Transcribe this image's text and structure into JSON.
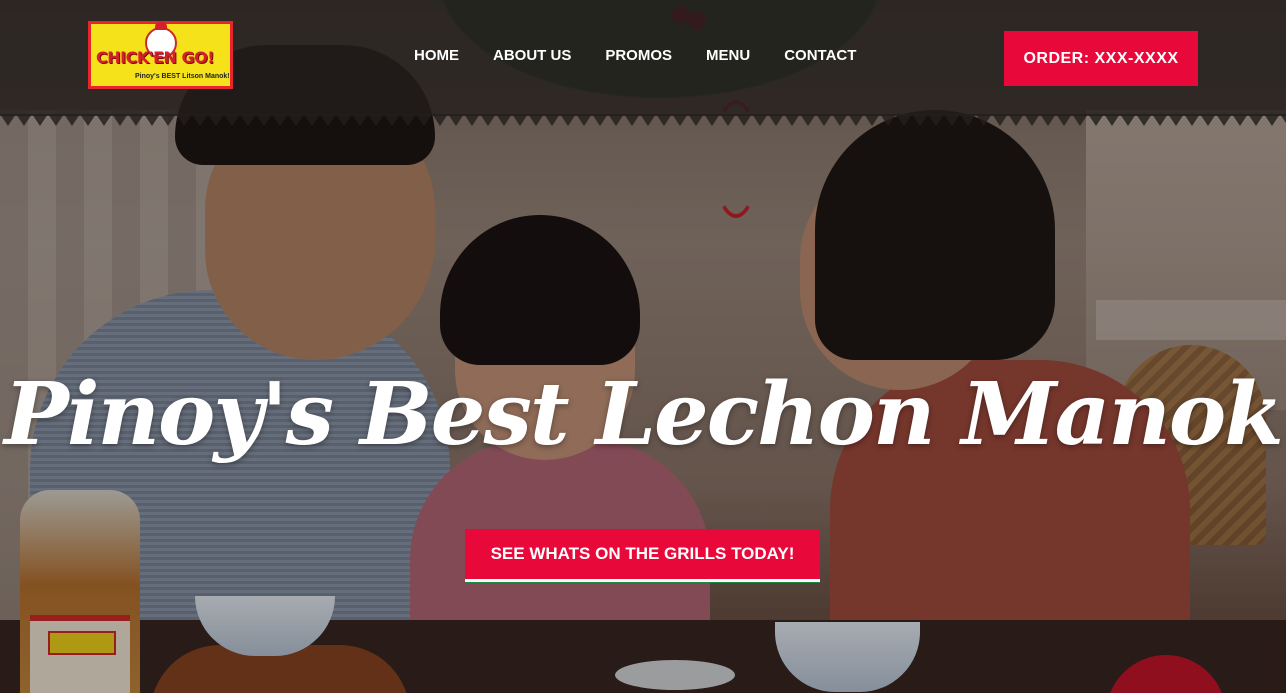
{
  "brand": {
    "logo_text": "CHICK'EN GO!",
    "logo_tagline": "Pinoy's BEST Litson Manok!"
  },
  "nav": {
    "items": [
      {
        "label": "HOME"
      },
      {
        "label": "ABOUT US"
      },
      {
        "label": "PROMOS"
      },
      {
        "label": "MENU"
      },
      {
        "label": "CONTACT"
      }
    ]
  },
  "header": {
    "order_label": "ORDER: XXX-XXXX"
  },
  "hero": {
    "headline": "Pinoy's Best Lechon Manok",
    "cta_label": "SEE WHATS ON THE GRILLS TODAY!"
  },
  "colors": {
    "accent": "#e8093a",
    "header_bg": "#231e1c",
    "logo_bg": "#f5e21a",
    "logo_border": "#e5262d",
    "cta_shadow": "#1a8a3a"
  },
  "icons": {
    "logo": "chicken-mascot-icon"
  }
}
